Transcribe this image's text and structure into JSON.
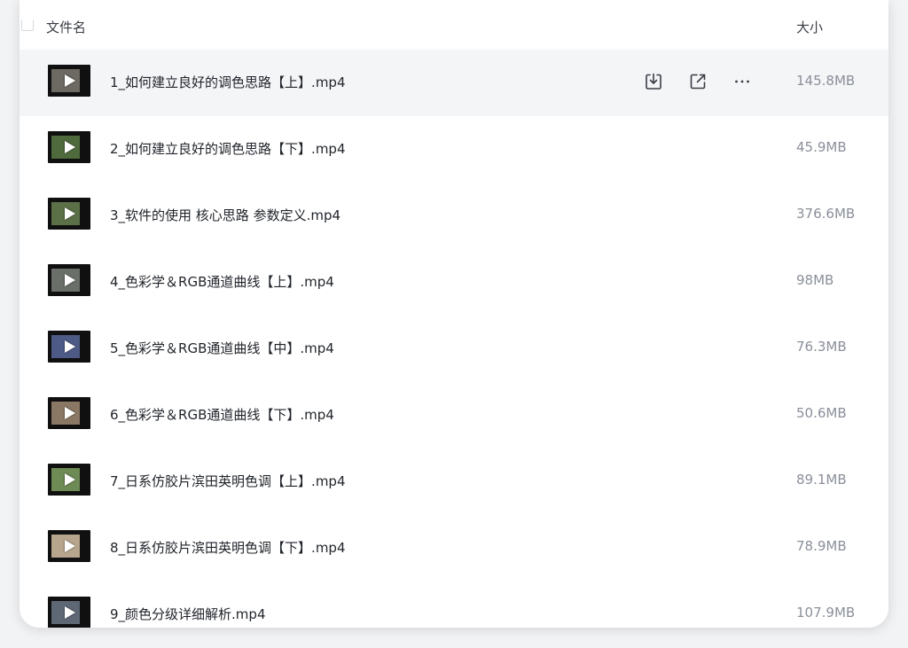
{
  "header": {
    "col_name": "文件名",
    "col_size": "大小"
  },
  "actions": {
    "download_icon": "download-icon",
    "share_icon": "share-external-icon",
    "more_icon": "more-horizontal-icon"
  },
  "files": [
    {
      "name": "1_如何建立良好的调色思路【上】.mp4",
      "size": "145.8MB",
      "thumb_color": "#6d6a63"
    },
    {
      "name": "2_如何建立良好的调色思路【下】.mp4",
      "size": "45.9MB",
      "thumb_color": "#4f6a3c"
    },
    {
      "name": "3_软件的使用 核心思路 参数定义.mp4",
      "size": "376.6MB",
      "thumb_color": "#5c7048"
    },
    {
      "name": "4_色彩学＆RGB通道曲线【上】.mp4",
      "size": "98MB",
      "thumb_color": "#6b6f6a"
    },
    {
      "name": "5_色彩学＆RGB通道曲线【中】.mp4",
      "size": "76.3MB",
      "thumb_color": "#4e5a86"
    },
    {
      "name": "6_色彩学＆RGB通道曲线【下】.mp4",
      "size": "50.6MB",
      "thumb_color": "#8a7865"
    },
    {
      "name": "7_日系仿胶片滨田英明色调【上】.mp4",
      "size": "89.1MB",
      "thumb_color": "#6e8a55"
    },
    {
      "name": "8_日系仿胶片滨田英明色调【下】.mp4",
      "size": "78.9MB",
      "thumb_color": "#b8a58e"
    },
    {
      "name": "9_颜色分级详细解析.mp4",
      "size": "107.9MB",
      "thumb_color": "#5d6874"
    }
  ],
  "hover_row": 0
}
